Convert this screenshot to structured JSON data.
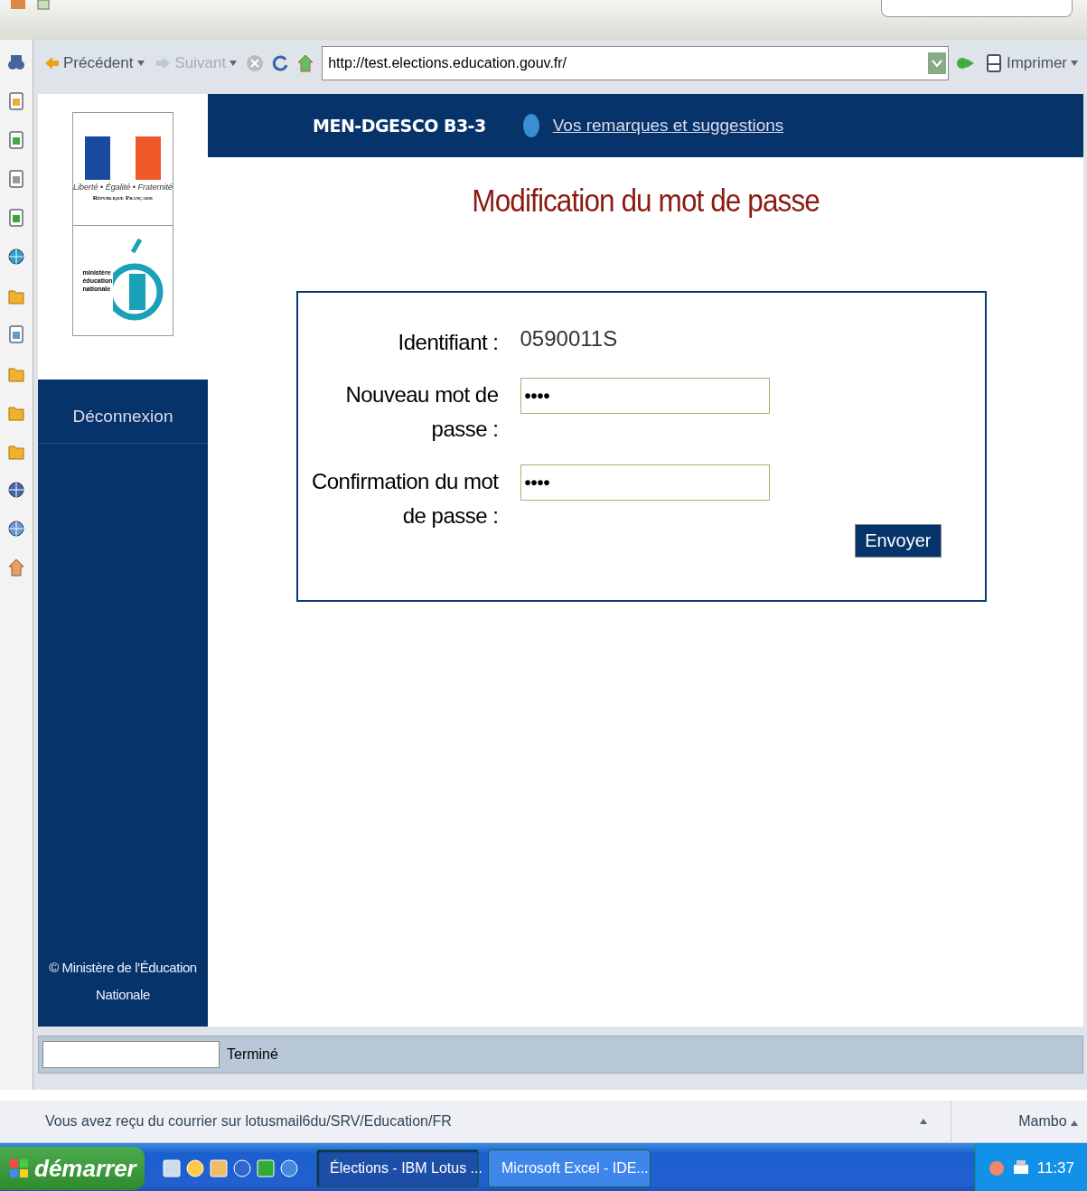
{
  "browser_toolbar": {
    "back": "Précédent",
    "forward": "Suivant",
    "address": "http://test.elections.education.gouv.fr/",
    "print": "Imprimer"
  },
  "sidebar": {
    "logo_motto": "Liberté • Égalité • Fraternité",
    "logo_republic": "République Française",
    "ministry_lines": [
      "ministère",
      "éducation",
      "nationale"
    ],
    "logout": "Déconnexion",
    "footer": "© Ministère de l'Éducation Nationale"
  },
  "header": {
    "title": "MEN-DGESCO B3-3",
    "feedback_link": "Vos remarques et suggestions"
  },
  "page_title": "Modification du mot de passe",
  "form": {
    "id_label": "Identifiant :",
    "id_value": "0590011S",
    "fields": [
      {
        "label": "Nouveau mot de passe :",
        "value": "••••"
      },
      {
        "label": "Confirmation du mot de passe :",
        "value": "••••"
      }
    ],
    "submit": "Envoyer"
  },
  "status_bar": {
    "text": "Terminé"
  },
  "notification_bar": {
    "message": "Vous avez reçu du courrier sur lotusmail6du/SRV/Education/FR",
    "location": "Mambo"
  },
  "taskbar": {
    "start": "démarrer",
    "tasks": [
      {
        "label": "Élections - IBM Lotus ...",
        "selected": true
      },
      {
        "label": "Microsoft Excel - IDE...",
        "selected": false
      }
    ],
    "clock": "11:37"
  }
}
